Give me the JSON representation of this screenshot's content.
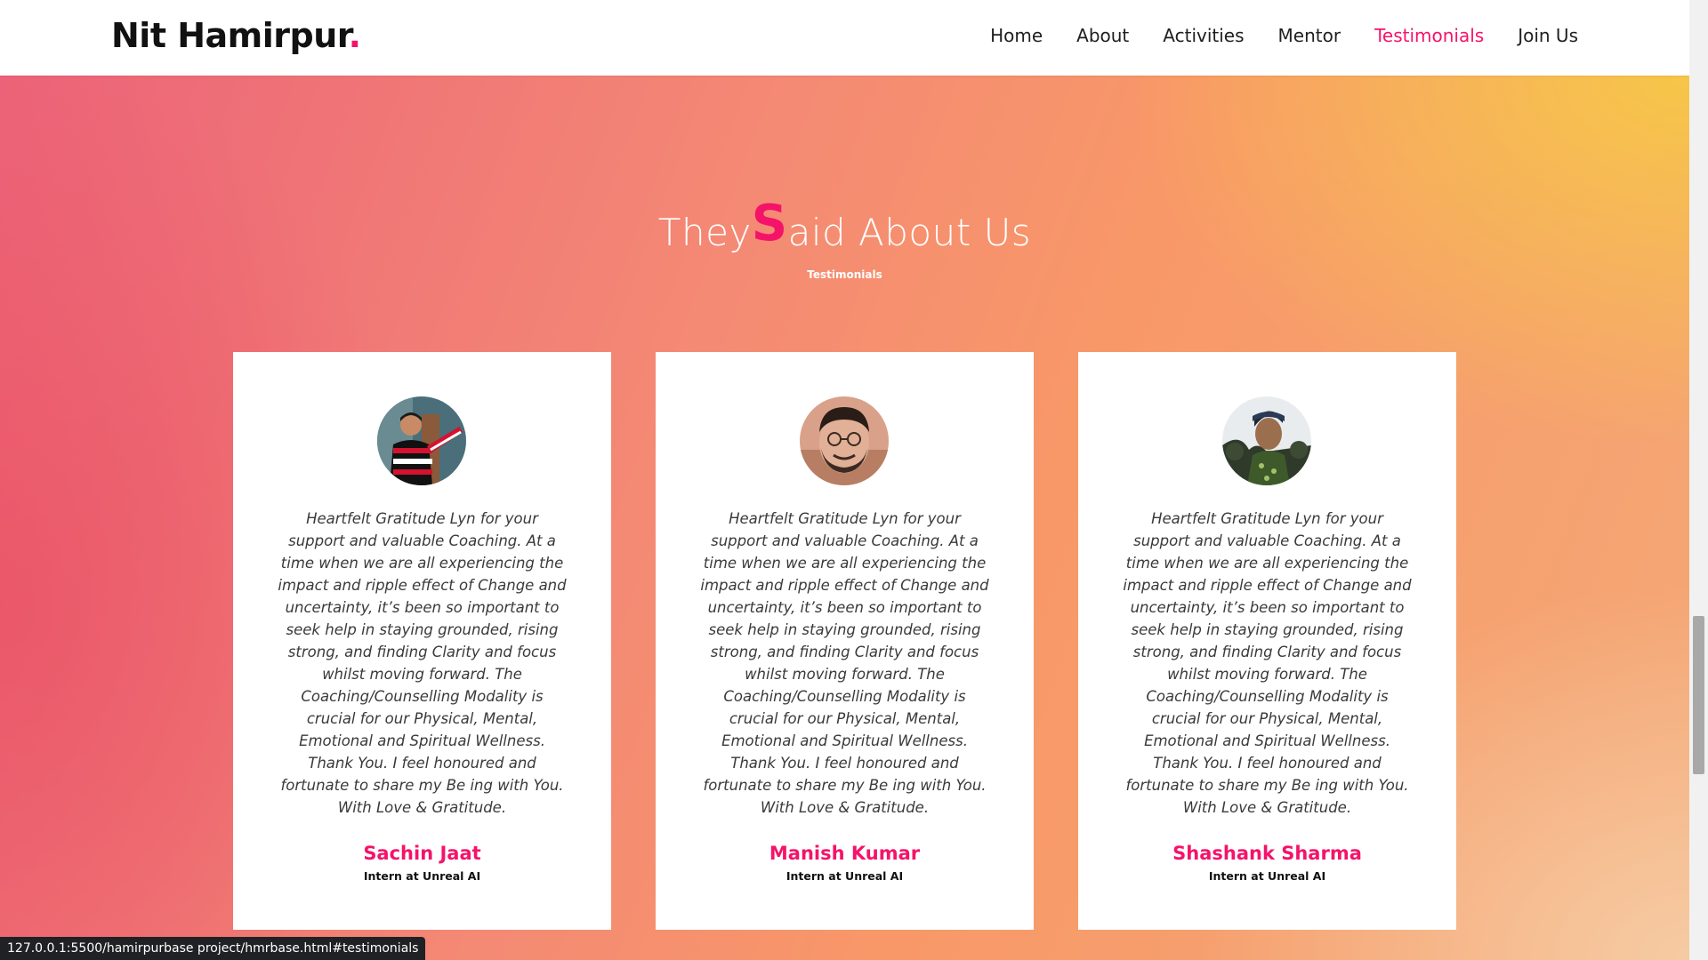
{
  "navbar": {
    "brand": "Nit Hamirpur",
    "brand_dot": ".",
    "links": [
      {
        "label": "Home"
      },
      {
        "label": "About"
      },
      {
        "label": "Activities"
      },
      {
        "label": "Mentor"
      },
      {
        "label": "Testimonials",
        "active": true
      },
      {
        "label": "Join Us"
      }
    ]
  },
  "section": {
    "title_pre": "They",
    "title_accent": "S",
    "title_post": "aid About Us",
    "subtitle": "Testimonials"
  },
  "testimonials": [
    {
      "name": "Sachin Jaat",
      "role": "Intern at Unreal AI",
      "quote": "Heartfelt Gratitude Lyn for your support and valuable Coaching. At a time when we are all experiencing the impact and ripple effect of Change and uncertainty, it’s been so important to seek help in staying grounded, rising strong, and finding Clarity and focus whilst moving forward. The Coaching/Counselling Modality is crucial for our Physical, Mental, Emotional and Spiritual Wellness. Thank You. I feel honoured and fortunate to share my Be ing with You. With Love & Gratitude."
    },
    {
      "name": "Manish Kumar",
      "role": "Intern at Unreal AI",
      "quote": "Heartfelt Gratitude Lyn for your support and valuable Coaching. At a time when we are all experiencing the impact and ripple effect of Change and uncertainty, it’s been so important to seek help in staying grounded, rising strong, and finding Clarity and focus whilst moving forward. The Coaching/Counselling Modality is crucial for our Physical, Mental, Emotional and Spiritual Wellness. Thank You. I feel honoured and fortunate to share my Be ing with You. With Love & Gratitude."
    },
    {
      "name": "Shashank Sharma",
      "role": "Intern at Unreal AI",
      "quote": "Heartfelt Gratitude Lyn for your support and valuable Coaching. At a time when we are all experiencing the impact and ripple effect of Change and uncertainty, it’s been so important to seek help in staying grounded, rising strong, and finding Clarity and focus whilst moving forward. The Coaching/Counselling Modality is crucial for our Physical, Mental, Emotional and Spiritual Wellness. Thank You. I feel honoured and fortunate to share my Be ing with You. With Love & Gratitude."
    }
  ],
  "status_bar": {
    "url": "127.0.0.1:5500/hamirpurbase project/hmrbase.html#testimonials"
  },
  "colors": {
    "accent": "#f5136a",
    "nav_text": "#1f1f1f",
    "card_bg": "#ffffff"
  }
}
